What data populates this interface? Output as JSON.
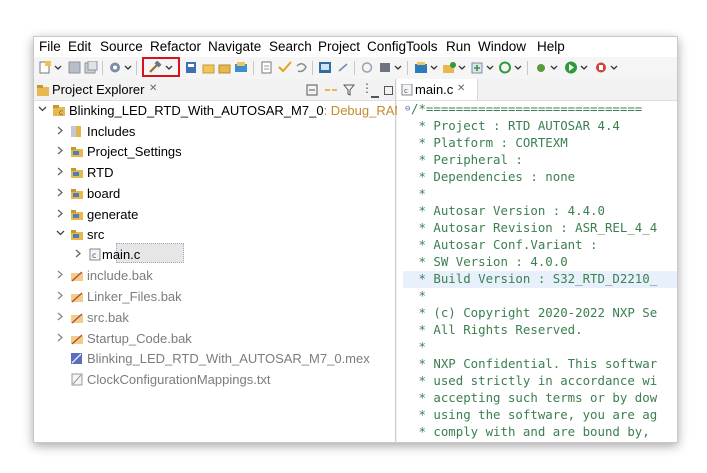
{
  "menu": [
    "File",
    "Edit",
    "Source",
    "Refactor",
    "Navigate",
    "Search",
    "Project",
    "ConfigTools",
    "Run",
    "Window",
    "Help"
  ],
  "toolbar_icons": [
    "new-icon",
    "save-icon",
    "save-all-icon",
    "settings-icon",
    "build-hammer-icon",
    "calc-icon",
    "new-folder-icon",
    "open-folder-icon",
    "package-icon",
    "file-icon",
    "check-icon",
    "undo-icon",
    "terminal-icon",
    "debug-icon",
    "run-icon",
    "stop-icon",
    "config-icon",
    "target-icon",
    "play-icon",
    "tools-icon"
  ],
  "highlight_color": "#d4141a",
  "explorer": {
    "title": "Project Explorer",
    "close": "✕",
    "project_name": "Blinking_LED_RTD_With_AUTOSAR_M7_0",
    "project_config": ": Debug_RAM",
    "items": [
      {
        "label": "Includes",
        "icon": "includes-icon"
      },
      {
        "label": "Project_Settings",
        "icon": "folder-icon"
      },
      {
        "label": "RTD",
        "icon": "folder-icon"
      },
      {
        "label": "board",
        "icon": "folder-icon"
      },
      {
        "label": "generate",
        "icon": "folder-icon"
      },
      {
        "label": "src",
        "icon": "folder-icon"
      },
      {
        "label": "main.c",
        "icon": "c-file-icon"
      },
      {
        "label": "include.bak",
        "icon": "excluded-folder-icon"
      },
      {
        "label": "Linker_Files.bak",
        "icon": "excluded-folder-icon"
      },
      {
        "label": "src.bak",
        "icon": "excluded-folder-icon"
      },
      {
        "label": "Startup_Code.bak",
        "icon": "excluded-folder-icon"
      },
      {
        "label": "Blinking_LED_RTD_With_AUTOSAR_M7_0.mex",
        "icon": "mex-file-icon"
      },
      {
        "label": "ClockConfigurationMappings.txt",
        "icon": "txt-file-icon"
      }
    ]
  },
  "editor": {
    "tab": "main.c",
    "close": "✕",
    "lines": [
      "/*=============================",
      " * Project : RTD AUTOSAR 4.4",
      " * Platform : CORTEXM",
      " * Peripheral : ",
      " * Dependencies : none",
      " *",
      " * Autosar Version : 4.4.0",
      " * Autosar Revision : ASR_REL_4_4",
      " * Autosar Conf.Variant : ",
      " * SW Version : 4.0.0",
      " * Build Version : S32_RTD_D2210_",
      " *",
      " * (c) Copyright 2020-2022 NXP Se",
      " * All Rights Reserved.",
      " *",
      " * NXP Confidential. This softwar",
      " * used strictly in accordance wi",
      " * accepting such terms or by dow",
      " * using the software, you are ag",
      " * comply with and are bound by, "
    ]
  }
}
